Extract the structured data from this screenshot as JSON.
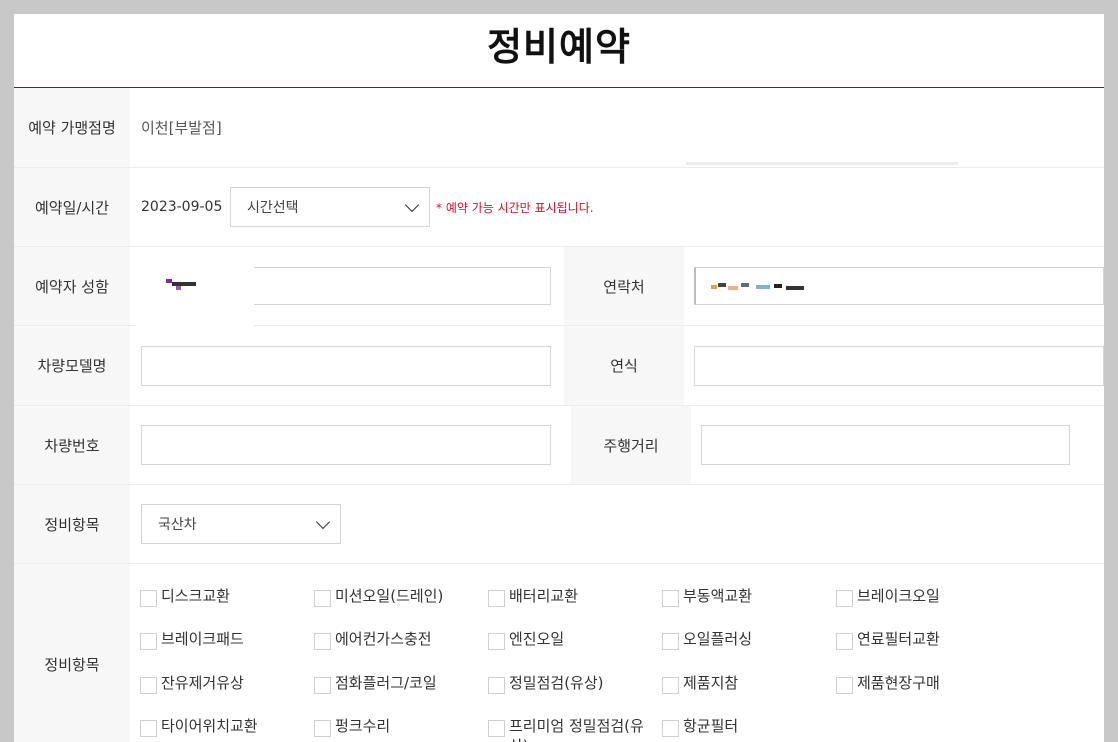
{
  "title": "정비예약",
  "branch": {
    "label": "예약 가맹점명",
    "value": "이천[부발점]"
  },
  "datetime": {
    "label": "예약일/시간",
    "date": "2023-09-05",
    "time_select": "시간선택",
    "note": "* 예약 가능 시간만 표시됩니다."
  },
  "name": {
    "label": "예약자 성함",
    "value": ""
  },
  "contact": {
    "label": "연락처",
    "value": ""
  },
  "car_model": {
    "label": "차량모델명",
    "value": ""
  },
  "year": {
    "label": "연식",
    "value": ""
  },
  "car_number": {
    "label": "차량번호",
    "value": ""
  },
  "mileage": {
    "label": "주행거리",
    "value": ""
  },
  "service_type": {
    "label": "정비항목",
    "selected": "국산차"
  },
  "service_items": {
    "label": "정비항목",
    "items": [
      "디스크교환",
      "미션오일(드레인)",
      "배터리교환",
      "부동액교환",
      "브레이크오일",
      "브레이크패드",
      "에어컨가스충전",
      "엔진오일",
      "오일플러싱",
      "연료필터교환",
      "잔유제거유상",
      "점화플러그/코일",
      "정밀점검(유상)",
      "제품지참",
      "제품현장구매",
      "타이어위치교환",
      "펑크수리",
      "프리미엄 정밀점검(유상)",
      "항균필터"
    ]
  },
  "colors": {
    "accent": "#b30000",
    "note": "#d3122a"
  }
}
